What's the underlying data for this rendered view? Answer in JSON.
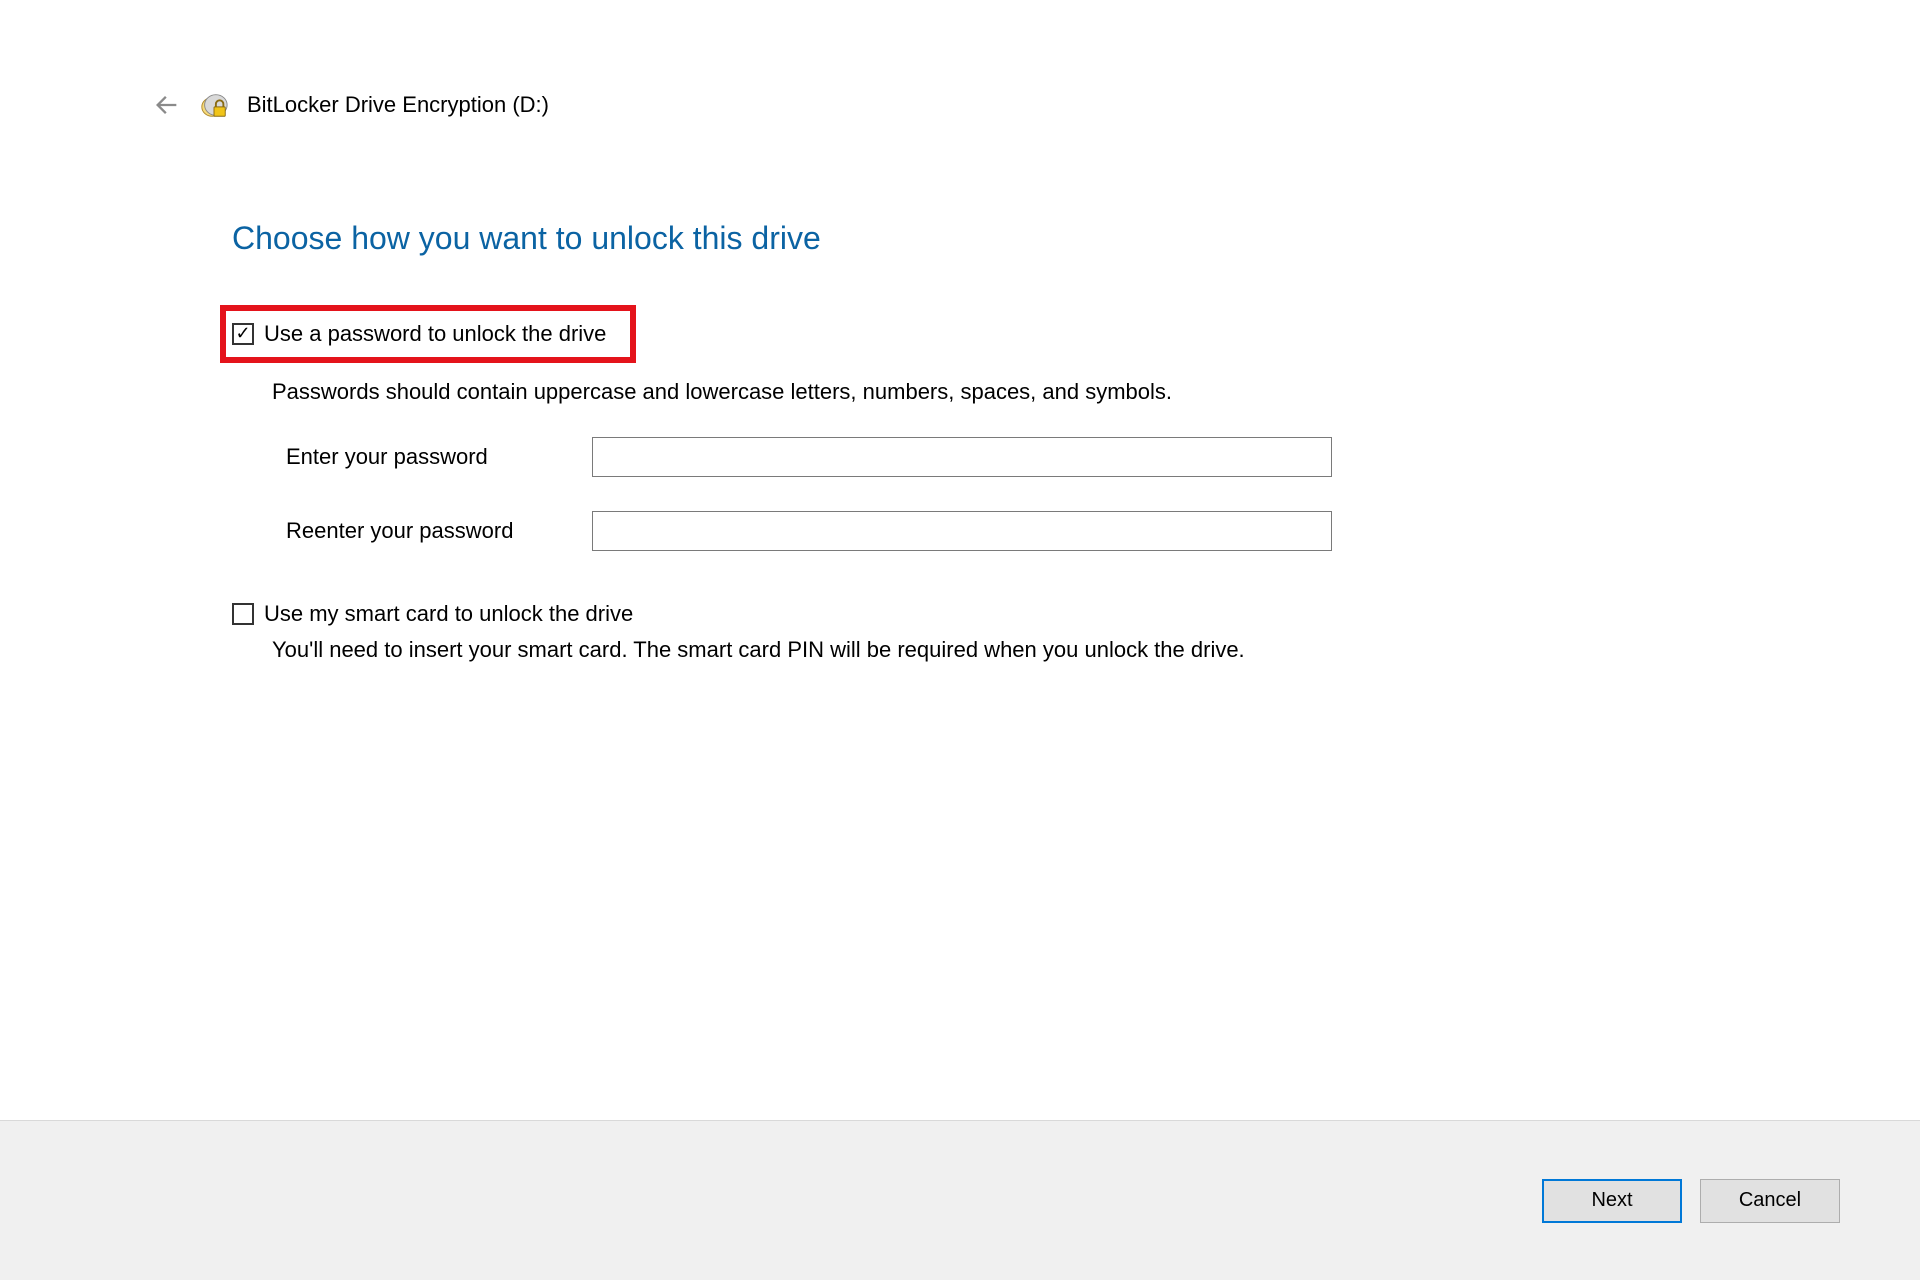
{
  "header": {
    "title": "BitLocker Drive Encryption (D:)"
  },
  "main": {
    "heading": "Choose how you want to unlock this drive"
  },
  "passwordOption": {
    "checkbox_label": "Use a password to unlock the drive",
    "hint": "Passwords should contain uppercase and lowercase letters, numbers, spaces, and symbols.",
    "enter_label": "Enter your password",
    "reenter_label": "Reenter your password",
    "enter_value": "",
    "reenter_value": ""
  },
  "smartcardOption": {
    "checkbox_label": "Use my smart card to unlock the drive",
    "hint": "You'll need to insert your smart card. The smart card PIN will be required when you unlock the drive."
  },
  "footer": {
    "next_label": "Next",
    "cancel_label": "Cancel"
  }
}
